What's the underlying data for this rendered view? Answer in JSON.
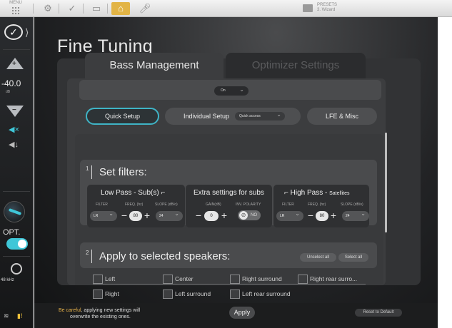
{
  "toolbar": {
    "menu_label": "MENU",
    "presets_line1": "PRESETS",
    "presets_line2": "3. Wizard"
  },
  "rail": {
    "volume": "-40.0",
    "volume_unit": "dB",
    "opt_label": "OPT.",
    "sample_rate": "48 kHz"
  },
  "page": {
    "title": "Fine Tuning"
  },
  "tabs": [
    {
      "label": "Bass Management",
      "active": true
    },
    {
      "label": "Optimizer Settings",
      "active": false
    }
  ],
  "master": {
    "value": "On"
  },
  "modes": {
    "quick": "Quick Setup",
    "individual": "Individual Setup",
    "quick_access": "Quick access",
    "lfe": "LFE & Misc"
  },
  "section1": {
    "number": "1",
    "title": "Set filters:",
    "low_pass": {
      "title": "Low Pass - Sub(s)",
      "filter_label": "FILTER",
      "freq_label": "FREQ. (hz)",
      "slope_label": "SLOPE (dB/o)",
      "filter": "LR",
      "freq": "80",
      "slope": "24"
    },
    "extra": {
      "title": "Extra settings for subs",
      "gain_label": "GAIN(dB)",
      "polarity_label": "INV. POLARITY",
      "gain": "0",
      "polarity": "NO"
    },
    "high_pass": {
      "title": "High Pass - ",
      "title_small": "Satellites",
      "filter_label": "FILTER",
      "freq_label": "FREQ. (hz)",
      "slope_label": "SLOPE (dB/o)",
      "filter": "LR",
      "freq": "80",
      "slope": "24"
    }
  },
  "section2": {
    "number": "2",
    "title": "Apply to selected speakers:",
    "unselect_all": "Unselect all",
    "select_all": "Select all",
    "speakers": [
      "Left",
      "Center",
      "Right surround",
      "Right rear surro...",
      "Right",
      "Left surround",
      "Left rear surround"
    ]
  },
  "footer": {
    "warning_highlight": "Be careful",
    "warning_rest": ", applying new settings will",
    "warning_line2": "overwrite the existing ones.",
    "apply": "Apply",
    "reset": "Reset to Default"
  },
  "colors": {
    "accent": "#3fc7d8",
    "warning": "#e6b24a",
    "active_tool": "#e2b445"
  }
}
